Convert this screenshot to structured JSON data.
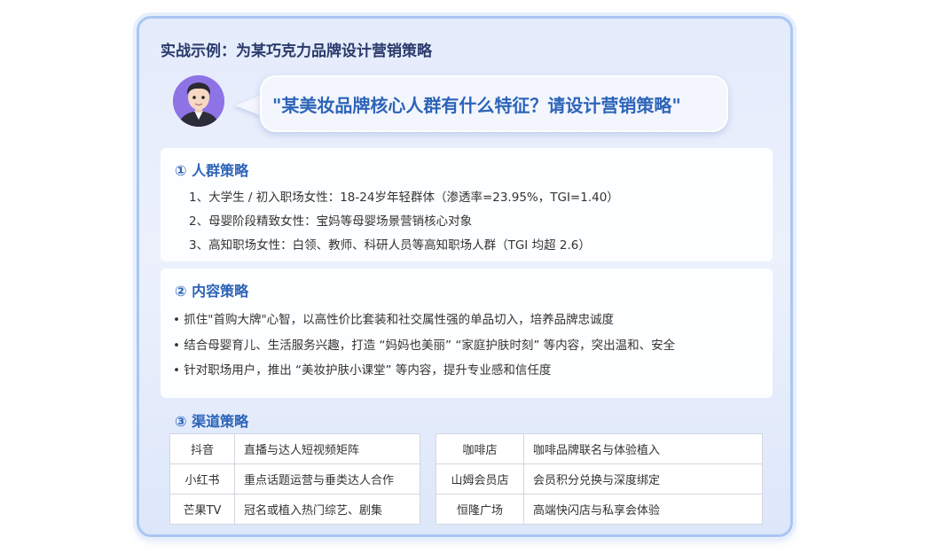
{
  "title": "实战示例：为某巧克力品牌设计营销策略",
  "question": "\"某美妆品牌核心人群有什么特征？请设计营销策略\"",
  "section1": {
    "heading": "① 人群策略",
    "items": [
      "1、大学生 / 初入职场女性：18-24岁年轻群体（渗透率=23.95%，TGI=1.40）",
      "2、母婴阶段精致女性：宝妈等母婴场景营销核心对象",
      "3、高知职场女性：白领、教师、科研人员等高知职场人群（TGI 均超 2.6）"
    ]
  },
  "section2": {
    "heading": "② 内容策略",
    "items": [
      "• 抓住\"首购大牌\"心智，以高性价比套装和社交属性强的单品切入，培养品牌忠诚度",
      "• 结合母婴育儿、生活服务兴趣，打造 “妈妈也美丽” “家庭护肤时刻” 等内容，突出温和、安全",
      "• 针对职场用户，推出 “美妆护肤小课堂” 等内容，提升专业感和信任度"
    ]
  },
  "section3": {
    "heading": "③ 渠道策略",
    "left_table": [
      {
        "channel": "抖音",
        "strategy": "直播与达人短视频矩阵"
      },
      {
        "channel": "小红书",
        "strategy": "重点话题运营与垂类达人合作"
      },
      {
        "channel": "芒果TV",
        "strategy": "冠名或植入热门综艺、剧集"
      }
    ],
    "right_table": [
      {
        "channel": "咖啡店",
        "strategy": "咖啡品牌联名与体验植入"
      },
      {
        "channel": "山姆会员店",
        "strategy": "会员积分兑换与深度绑定"
      },
      {
        "channel": "恒隆广场",
        "strategy": "高端快闪店与私享会体验"
      }
    ]
  },
  "colors": {
    "accent": "#2d64b8",
    "title": "#2a3a6b",
    "avatar_bg": "#8d73e6",
    "card_border": "#a9c6f3"
  }
}
